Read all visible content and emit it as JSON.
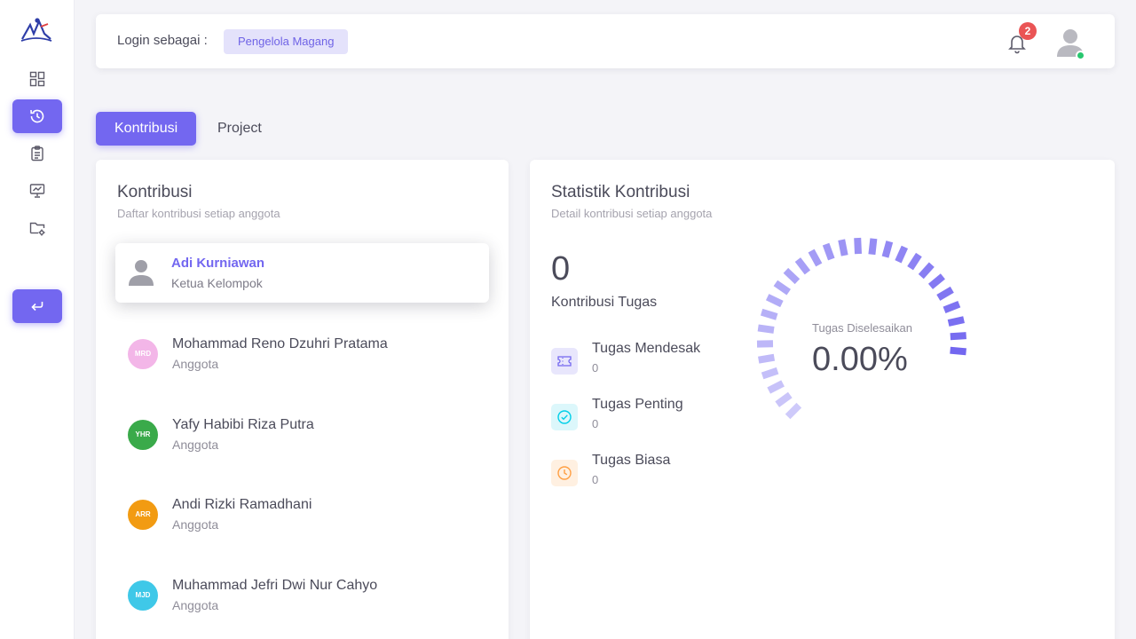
{
  "sidebar": {
    "items": [
      {
        "name": "dashboard-icon"
      },
      {
        "name": "history-icon",
        "active": true
      },
      {
        "name": "clipboard-icon"
      },
      {
        "name": "presentation-icon"
      },
      {
        "name": "folder-settings-icon"
      }
    ],
    "logout_icon": "logout-icon"
  },
  "topbar": {
    "login_label": "Login sebagai :",
    "role": "Pengelola Magang",
    "notification_count": "2"
  },
  "tabs": [
    {
      "label": "Kontribusi",
      "active": true
    },
    {
      "label": "Project",
      "active": false
    }
  ],
  "contributions": {
    "title": "Kontribusi",
    "subtitle": "Daftar kontribusi setiap anggota",
    "leader": {
      "name": "Adi Kurniawan",
      "role": "Ketua Kelompok"
    },
    "members": [
      {
        "initials": "MRD",
        "name": "Mohammad Reno Dzuhri Pratama",
        "role": "Anggota",
        "color": "#f3b6e8"
      },
      {
        "initials": "YHR",
        "name": "Yafy Habibi Riza Putra",
        "role": "Anggota",
        "color": "#3aaa4a"
      },
      {
        "initials": "ARR",
        "name": "Andi Rizki Ramadhani",
        "role": "Anggota",
        "color": "#f29b12"
      },
      {
        "initials": "MJD",
        "name": "Muhammad Jefri Dwi Nur Cahyo",
        "role": "Anggota",
        "color": "#3fc8e8"
      }
    ]
  },
  "statistics": {
    "title": "Statistik Kontribusi",
    "subtitle": "Detail kontribusi setiap anggota",
    "total_count": "0",
    "total_label": "Kontribusi Tugas",
    "items": [
      {
        "label": "Tugas Mendesak",
        "value": "0",
        "icon": "ticket-icon",
        "color": "#7367f0",
        "bg": "#e8e6fc"
      },
      {
        "label": "Tugas Penting",
        "value": "0",
        "icon": "check-circle-icon",
        "color": "#00cfe8",
        "bg": "#dcf7fb"
      },
      {
        "label": "Tugas Biasa",
        "value": "0",
        "icon": "clock-icon",
        "color": "#ff9f43",
        "bg": "#fff0e1"
      }
    ],
    "gauge": {
      "label": "Tugas Diselesaikan",
      "value": "0.00%",
      "percent": 0
    }
  },
  "colors": {
    "accent": "#7367f0",
    "danger": "#ea5455",
    "success": "#28c76f"
  }
}
